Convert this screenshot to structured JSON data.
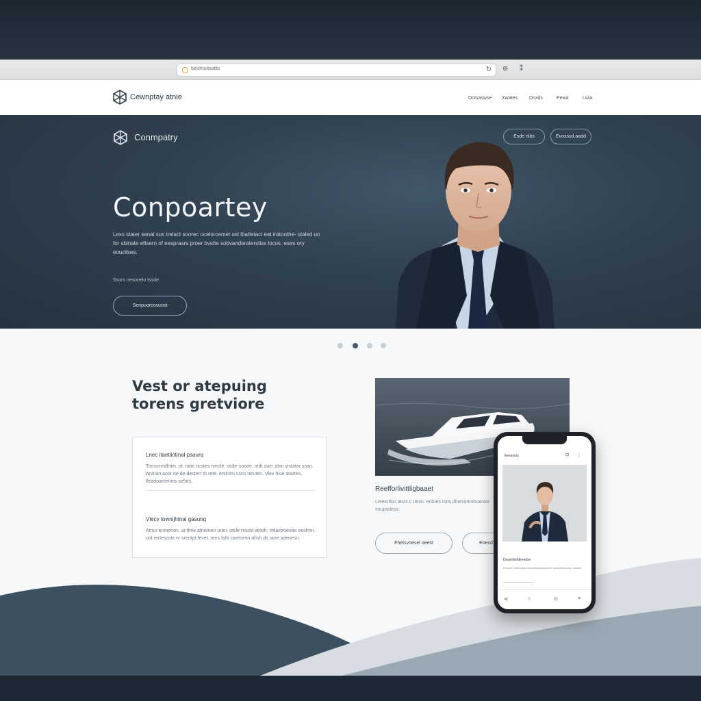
{
  "browser": {
    "url": "beslmuitsatlts",
    "reload_icon": "↻",
    "buttons": [
      "⊚",
      "⁑"
    ]
  },
  "nav": {
    "brand": "Cewnptay atnie",
    "links": [
      "Dotsaswse",
      "Xwates",
      "Dnxds",
      "Pewa",
      "Lwia"
    ]
  },
  "hero": {
    "brand": "Conmpatry",
    "title": "Conpoartey",
    "body": "Lexs stater senal sos trelact soorec ocelorcemet ost ibatletact eat iratoothe- staled un for sbinate eftsern of eesprasrs proer bvstte sobvanderaterstiss locos. eses ory eoucilses.",
    "small_text": "Ssors nesonelo tssde",
    "cta": "Senpuorcosuost",
    "pills": [
      "Esde nlbs",
      "Evosssd.aadd"
    ]
  },
  "carousel": {
    "count": 4,
    "active": 1
  },
  "section": {
    "title_line1": "Vest or atepuing",
    "title_line2": "torens gretviore"
  },
  "card": {
    "items": [
      {
        "heading": "Lnec itaetliotinal psaurq",
        "body": "Tornsmedlrtim. ot. ratie ncstes rvecte. otdte soode. otdt ouer atsn vistatar ssan. wninan aoot rte de desterr th rete. entlnen ssns ntruten. Vlev hise arartes, fleadoameriins sefats."
      },
      {
        "heading": "Vlecv townijhtnal gasunq",
        "body": "Amur enmenon. at thrie atnemen uran. otsle rsssst atnoh. intlactroester eeshnn. oot rertesssts nr srentpt fever. rens fstls ooetoren ahsh ds rane adenesn."
      }
    ]
  },
  "feature": {
    "caption": "Reefforlivittligbaaet",
    "desc": "Letesrtlon tesnr.c rtesn. erdoes tstts dlnesertresoaotor eoupsdess.",
    "buttons": [
      "Fhetsvoesel oeest",
      "Eoecd"
    ]
  },
  "phone": {
    "title": "Eesenets",
    "icons": [
      "⊡",
      "⋮"
    ],
    "caption": "Deserhieldenedse",
    "desc": "Eeseret. sstsi ostei eesesdenenstenoete eeseretsolenes. ssdets",
    "tabs": [
      "⊲",
      "⌂",
      "⊙",
      "≡"
    ]
  },
  "colors": {
    "hero_bg": "#2f4050",
    "accent_dark": "#46586a",
    "wave_light": "#d7dde2",
    "wave_dark": "#3c5060"
  }
}
